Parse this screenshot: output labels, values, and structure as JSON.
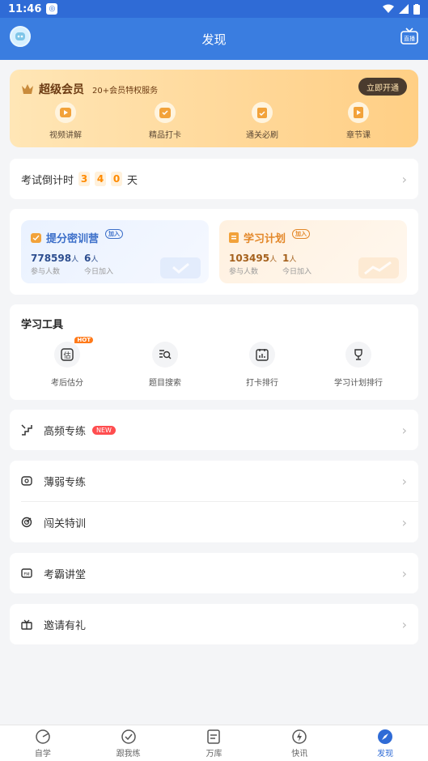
{
  "status": {
    "time": "11:46"
  },
  "appbar": {
    "title": "发现"
  },
  "vip": {
    "title": "超级会员",
    "subtitle": "20+会员特权服务",
    "open_label": "立即开通",
    "features": [
      "视频讲解",
      "精品打卡",
      "通关必刷",
      "章节课"
    ]
  },
  "countdown": {
    "label": "考试倒计时",
    "digits": [
      "3",
      "4",
      "0"
    ],
    "unit": "天"
  },
  "training": [
    {
      "title": "提分密训营",
      "badge": "加入",
      "count": "778598",
      "count_unit": "人",
      "count_caption": "参与人数",
      "today": "6",
      "today_unit": "人",
      "today_caption": "今日加入"
    },
    {
      "title": "学习计划",
      "badge": "加入",
      "count": "103495",
      "count_unit": "人",
      "count_caption": "参与人数",
      "today": "1",
      "today_unit": "人",
      "today_caption": "今日加入"
    }
  ],
  "tools": {
    "heading": "学习工具",
    "hot_badge": "HOT",
    "items": [
      "考后估分",
      "题目搜索",
      "打卡排行",
      "学习计划排行"
    ]
  },
  "menu": {
    "high_freq": {
      "label": "高频专练",
      "badge": "NEW"
    },
    "weak": {
      "label": "薄弱专练"
    },
    "level": {
      "label": "闯关特训"
    },
    "lecture": {
      "label": "考霸讲堂"
    },
    "invite": {
      "label": "邀请有礼"
    }
  },
  "nav": [
    "自学",
    "跟我练",
    "万库",
    "快讯",
    "发现"
  ],
  "colors": {
    "primary": "#3a7de0",
    "accent": "#ff8a00",
    "active_nav": "#2f6bd6"
  }
}
